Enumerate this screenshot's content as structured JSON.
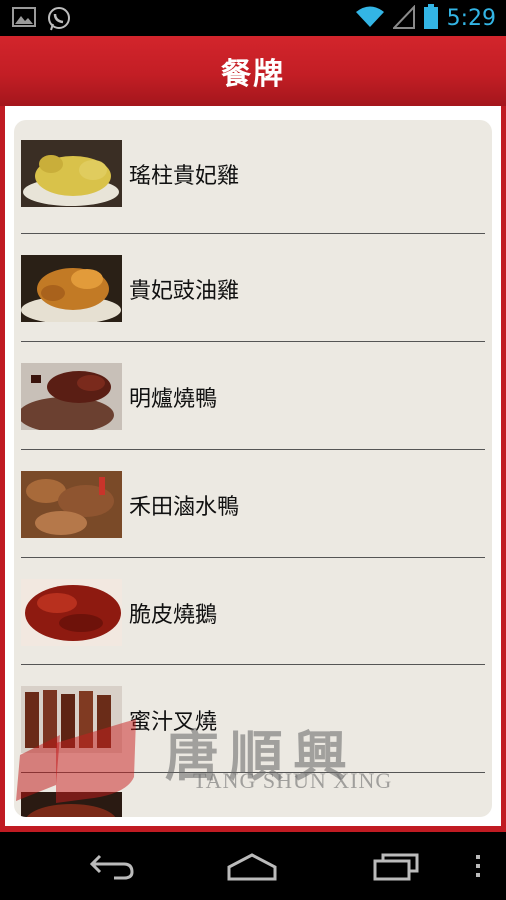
{
  "status_bar": {
    "time": "5:29",
    "icons": [
      "gallery-icon",
      "whatsapp-icon",
      "wifi-icon",
      "signal-icon",
      "battery-icon"
    ]
  },
  "app_bar": {
    "title": "餐牌"
  },
  "menu": {
    "items": [
      {
        "label": "瑤柱貴妃雞",
        "thumb": "poached-chicken"
      },
      {
        "label": "貴妃豉油雞",
        "thumb": "soy-chicken"
      },
      {
        "label": "明爐燒鴨",
        "thumb": "roast-duck"
      },
      {
        "label": "禾田滷水鴨",
        "thumb": "braised-duck"
      },
      {
        "label": "脆皮燒鵝",
        "thumb": "roast-goose"
      },
      {
        "label": "蜜汁叉燒",
        "thumb": "char-siu"
      }
    ]
  },
  "watermark": {
    "chinese": "唐順興",
    "latin": "TANG SHUN XING"
  },
  "nav_bar": {
    "icons": [
      "back-icon",
      "home-icon",
      "recent-apps-icon",
      "overflow-menu-icon"
    ]
  },
  "colors": {
    "brand_red": "#c31e25",
    "panel": "#ece9e2",
    "status_time": "#33b5e5"
  }
}
